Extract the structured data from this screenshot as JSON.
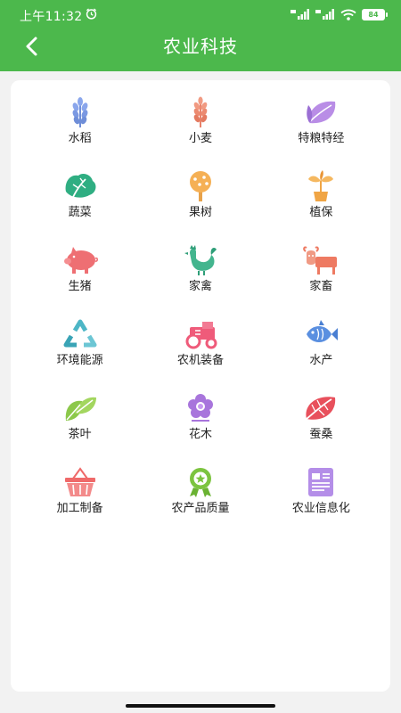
{
  "status": {
    "time": "上午11:32",
    "battery": "84"
  },
  "header": {
    "title": "农业科技"
  },
  "categories": [
    {
      "label": "水稻",
      "icon": "rice-icon"
    },
    {
      "label": "小麦",
      "icon": "wheat-icon"
    },
    {
      "label": "特粮特经",
      "icon": "special-crops-icon"
    },
    {
      "label": "蔬菜",
      "icon": "vegetable-icon"
    },
    {
      "label": "果树",
      "icon": "fruit-tree-icon"
    },
    {
      "label": "植保",
      "icon": "plant-protection-icon"
    },
    {
      "label": "生猪",
      "icon": "pig-icon"
    },
    {
      "label": "家禽",
      "icon": "rooster-icon"
    },
    {
      "label": "家畜",
      "icon": "cattle-icon"
    },
    {
      "label": "环境能源",
      "icon": "recycle-icon"
    },
    {
      "label": "农机装备",
      "icon": "tractor-icon"
    },
    {
      "label": "水产",
      "icon": "fish-icon"
    },
    {
      "label": "茶叶",
      "icon": "tea-leaf-icon"
    },
    {
      "label": "花木",
      "icon": "flower-icon"
    },
    {
      "label": "蚕桑",
      "icon": "mulberry-leaf-icon"
    },
    {
      "label": "加工制备",
      "icon": "basket-icon"
    },
    {
      "label": "农产品质量",
      "icon": "quality-badge-icon"
    },
    {
      "label": "农业信息化",
      "icon": "document-icon"
    }
  ],
  "colors": {
    "header": "#4cb84c",
    "background": "#f2f2f2"
  }
}
